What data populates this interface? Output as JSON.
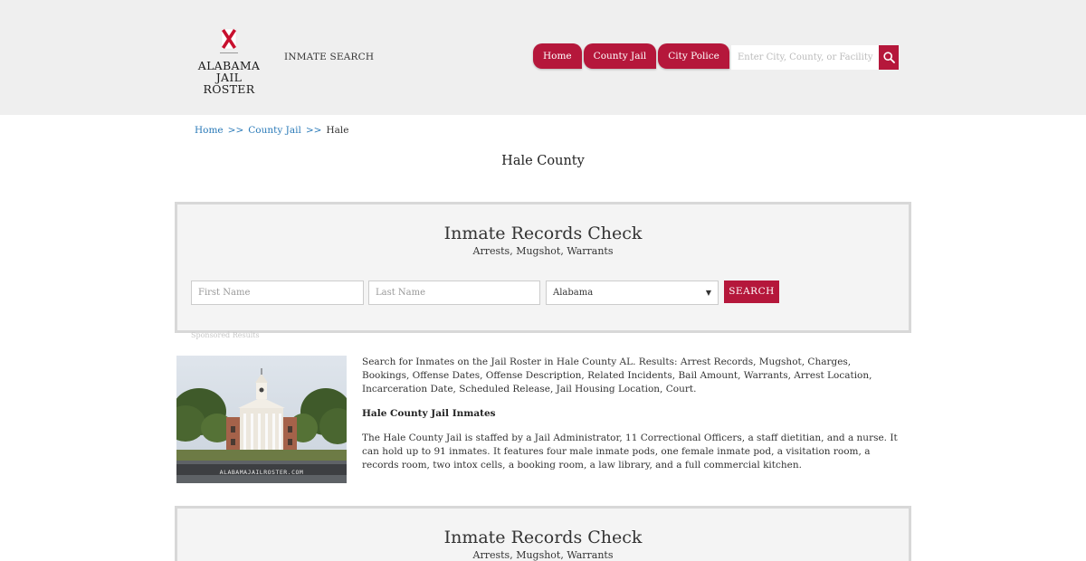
{
  "header": {
    "logo": {
      "line1": "ALABAMA",
      "line2": "JAIL ROSTER"
    },
    "inmate_search_label": "INMATE SEARCH",
    "nav": [
      {
        "label": "Home"
      },
      {
        "label": "County Jail"
      },
      {
        "label": "City Police"
      }
    ],
    "search_placeholder": "Enter City, County, or Facility",
    "accent_color": "#b5173b"
  },
  "breadcrumb": {
    "items": [
      "Home",
      "County Jail",
      "Hale"
    ],
    "separator": ">>"
  },
  "page_title": "Hale County",
  "records_check": {
    "title": "Inmate Records Check",
    "subtitle": "Arrests, Mugshot, Warrants",
    "first_name_placeholder": "First Name",
    "last_name_placeholder": "Last Name",
    "state_selected": "Alabama",
    "search_label": "SEARCH"
  },
  "sponsored_label": "Sponsored Results",
  "content": {
    "image_watermark": "ALABAMAJAILROSTER.COM",
    "intro": "Search for Inmates on the Jail Roster in Hale County AL. Results: Arrest Records, Mugshot, Charges, Bookings, Offense Dates, Offense Description, Related Incidents, Bail Amount, Warrants, Arrest Location, Incarceration Date, Scheduled Release, Jail Housing Location, Court.",
    "heading": "Hale County Jail Inmates",
    "body": "The Hale County Jail is staffed by a Jail Administrator, 11 Correctional Officers, a staff dietitian, and a nurse. It can hold up to 91 inmates. It features four male inmate pods, one female inmate pod, a visitation room, a records room, two intox cells, a booking room, a law library, and a full commercial kitchen."
  }
}
